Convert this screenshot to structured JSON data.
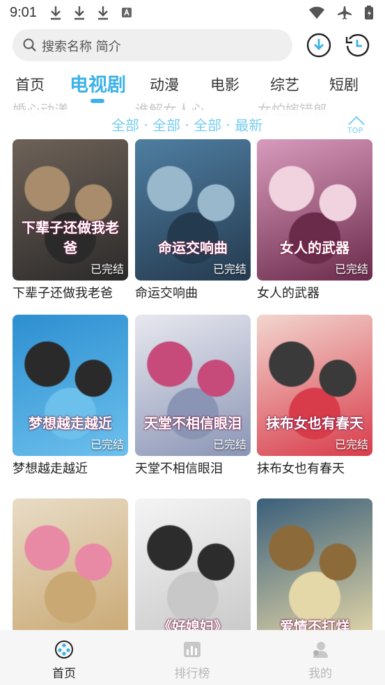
{
  "status": {
    "time": "9:01"
  },
  "search": {
    "placeholder": "搜索名称 简介"
  },
  "tabs": [
    {
      "label": "首页"
    },
    {
      "label": "电视剧"
    },
    {
      "label": "动漫"
    },
    {
      "label": "电影"
    },
    {
      "label": "综艺"
    },
    {
      "label": "短剧"
    }
  ],
  "filter": {
    "text": "全部 · 全部 · 全部 · 最新",
    "top_label": "TOP",
    "ghost_titles": [
      "婚心动漾",
      "谁解女人心",
      "女怕嫁错郎"
    ]
  },
  "badge_finished": "已完结",
  "shows": [
    {
      "title": "下辈子还做我老爸",
      "poster_text": "下辈子还做我老爸",
      "finished": true,
      "colors": [
        "#6e6258",
        "#2b2a2a",
        "#a88c6b"
      ]
    },
    {
      "title": "命运交响曲",
      "poster_text": "命运交响曲",
      "finished": true,
      "colors": [
        "#4f7ea1",
        "#243a4f",
        "#9ab8cc"
      ]
    },
    {
      "title": "女人的武器",
      "poster_text": "女人的武器",
      "finished": true,
      "colors": [
        "#d99bbd",
        "#6a2a4a",
        "#f1d3e0"
      ]
    },
    {
      "title": "梦想越走越近",
      "poster_text": "梦想越走越近",
      "finished": true,
      "colors": [
        "#2d8fd1",
        "#6cc0ec",
        "#2a2a2a"
      ]
    },
    {
      "title": "天堂不相信眼泪",
      "poster_text": "天堂不相信眼泪",
      "finished": true,
      "colors": [
        "#e8e8ef",
        "#8a95b5",
        "#c64a7a"
      ]
    },
    {
      "title": "抹布女也有春天",
      "poster_text": "抹布女也有春天",
      "finished": true,
      "colors": [
        "#f2d6cf",
        "#d83b4a",
        "#3a3a3a"
      ]
    },
    {
      "title": "",
      "poster_text": "",
      "finished": false,
      "colors": [
        "#e8dcc6",
        "#c9a873",
        "#e88aa5"
      ]
    },
    {
      "title": "",
      "poster_text": "《好媳妇》",
      "finished": false,
      "colors": [
        "#f4f4f4",
        "#c8c8c8",
        "#2c2c2c"
      ]
    },
    {
      "title": "",
      "poster_text": "爱情不打烊",
      "finished": false,
      "colors": [
        "#3a5f7a",
        "#e4d7a8",
        "#8d6a3a"
      ]
    }
  ],
  "bottom_nav": [
    {
      "label": "首页",
      "icon": "film-reel-icon",
      "active": true
    },
    {
      "label": "排行榜",
      "icon": "bar-chart-icon",
      "active": false
    },
    {
      "label": "我的",
      "icon": "user-icon",
      "active": false
    }
  ]
}
